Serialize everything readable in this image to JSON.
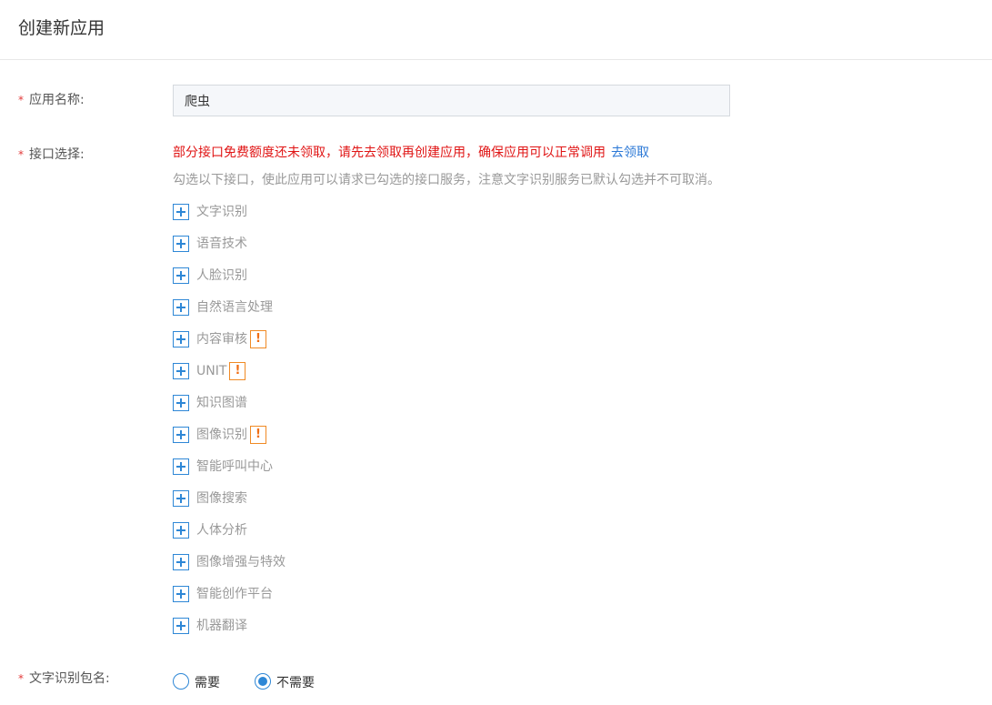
{
  "page": {
    "title": "创建新应用"
  },
  "form": {
    "name": {
      "label": "应用名称:",
      "value": "爬虫"
    },
    "api": {
      "label": "接口选择:",
      "warning": "部分接口免费额度还未领取，请先去领取再创建应用，确保应用可以正常调用",
      "warning_link": "去领取",
      "hint": "勾选以下接口，使此应用可以请求已勾选的接口服务，注意文字识别服务已默认勾选并不可取消。",
      "items": [
        {
          "label": "文字识别",
          "alert": false
        },
        {
          "label": "语音技术",
          "alert": false
        },
        {
          "label": "人脸识别",
          "alert": false
        },
        {
          "label": "自然语言处理",
          "alert": false
        },
        {
          "label": "内容审核",
          "alert": true
        },
        {
          "label": "UNIT",
          "alert": true
        },
        {
          "label": "知识图谱",
          "alert": false
        },
        {
          "label": "图像识别",
          "alert": true
        },
        {
          "label": "智能呼叫中心",
          "alert": false
        },
        {
          "label": "图像搜索",
          "alert": false
        },
        {
          "label": "人体分析",
          "alert": false
        },
        {
          "label": "图像增强与特效",
          "alert": false
        },
        {
          "label": "智能创作平台",
          "alert": false
        },
        {
          "label": "机器翻译",
          "alert": false
        }
      ],
      "alert_symbol": "!"
    },
    "ocr_package": {
      "label": "文字识别包名:",
      "options": [
        {
          "label": "需要",
          "checked": false
        },
        {
          "label": "不需要",
          "checked": true
        }
      ]
    },
    "required_mark": "*"
  },
  "colors": {
    "accent": "#2e87d6",
    "warning_text": "#e01515",
    "alert_orange": "#f08a24"
  }
}
